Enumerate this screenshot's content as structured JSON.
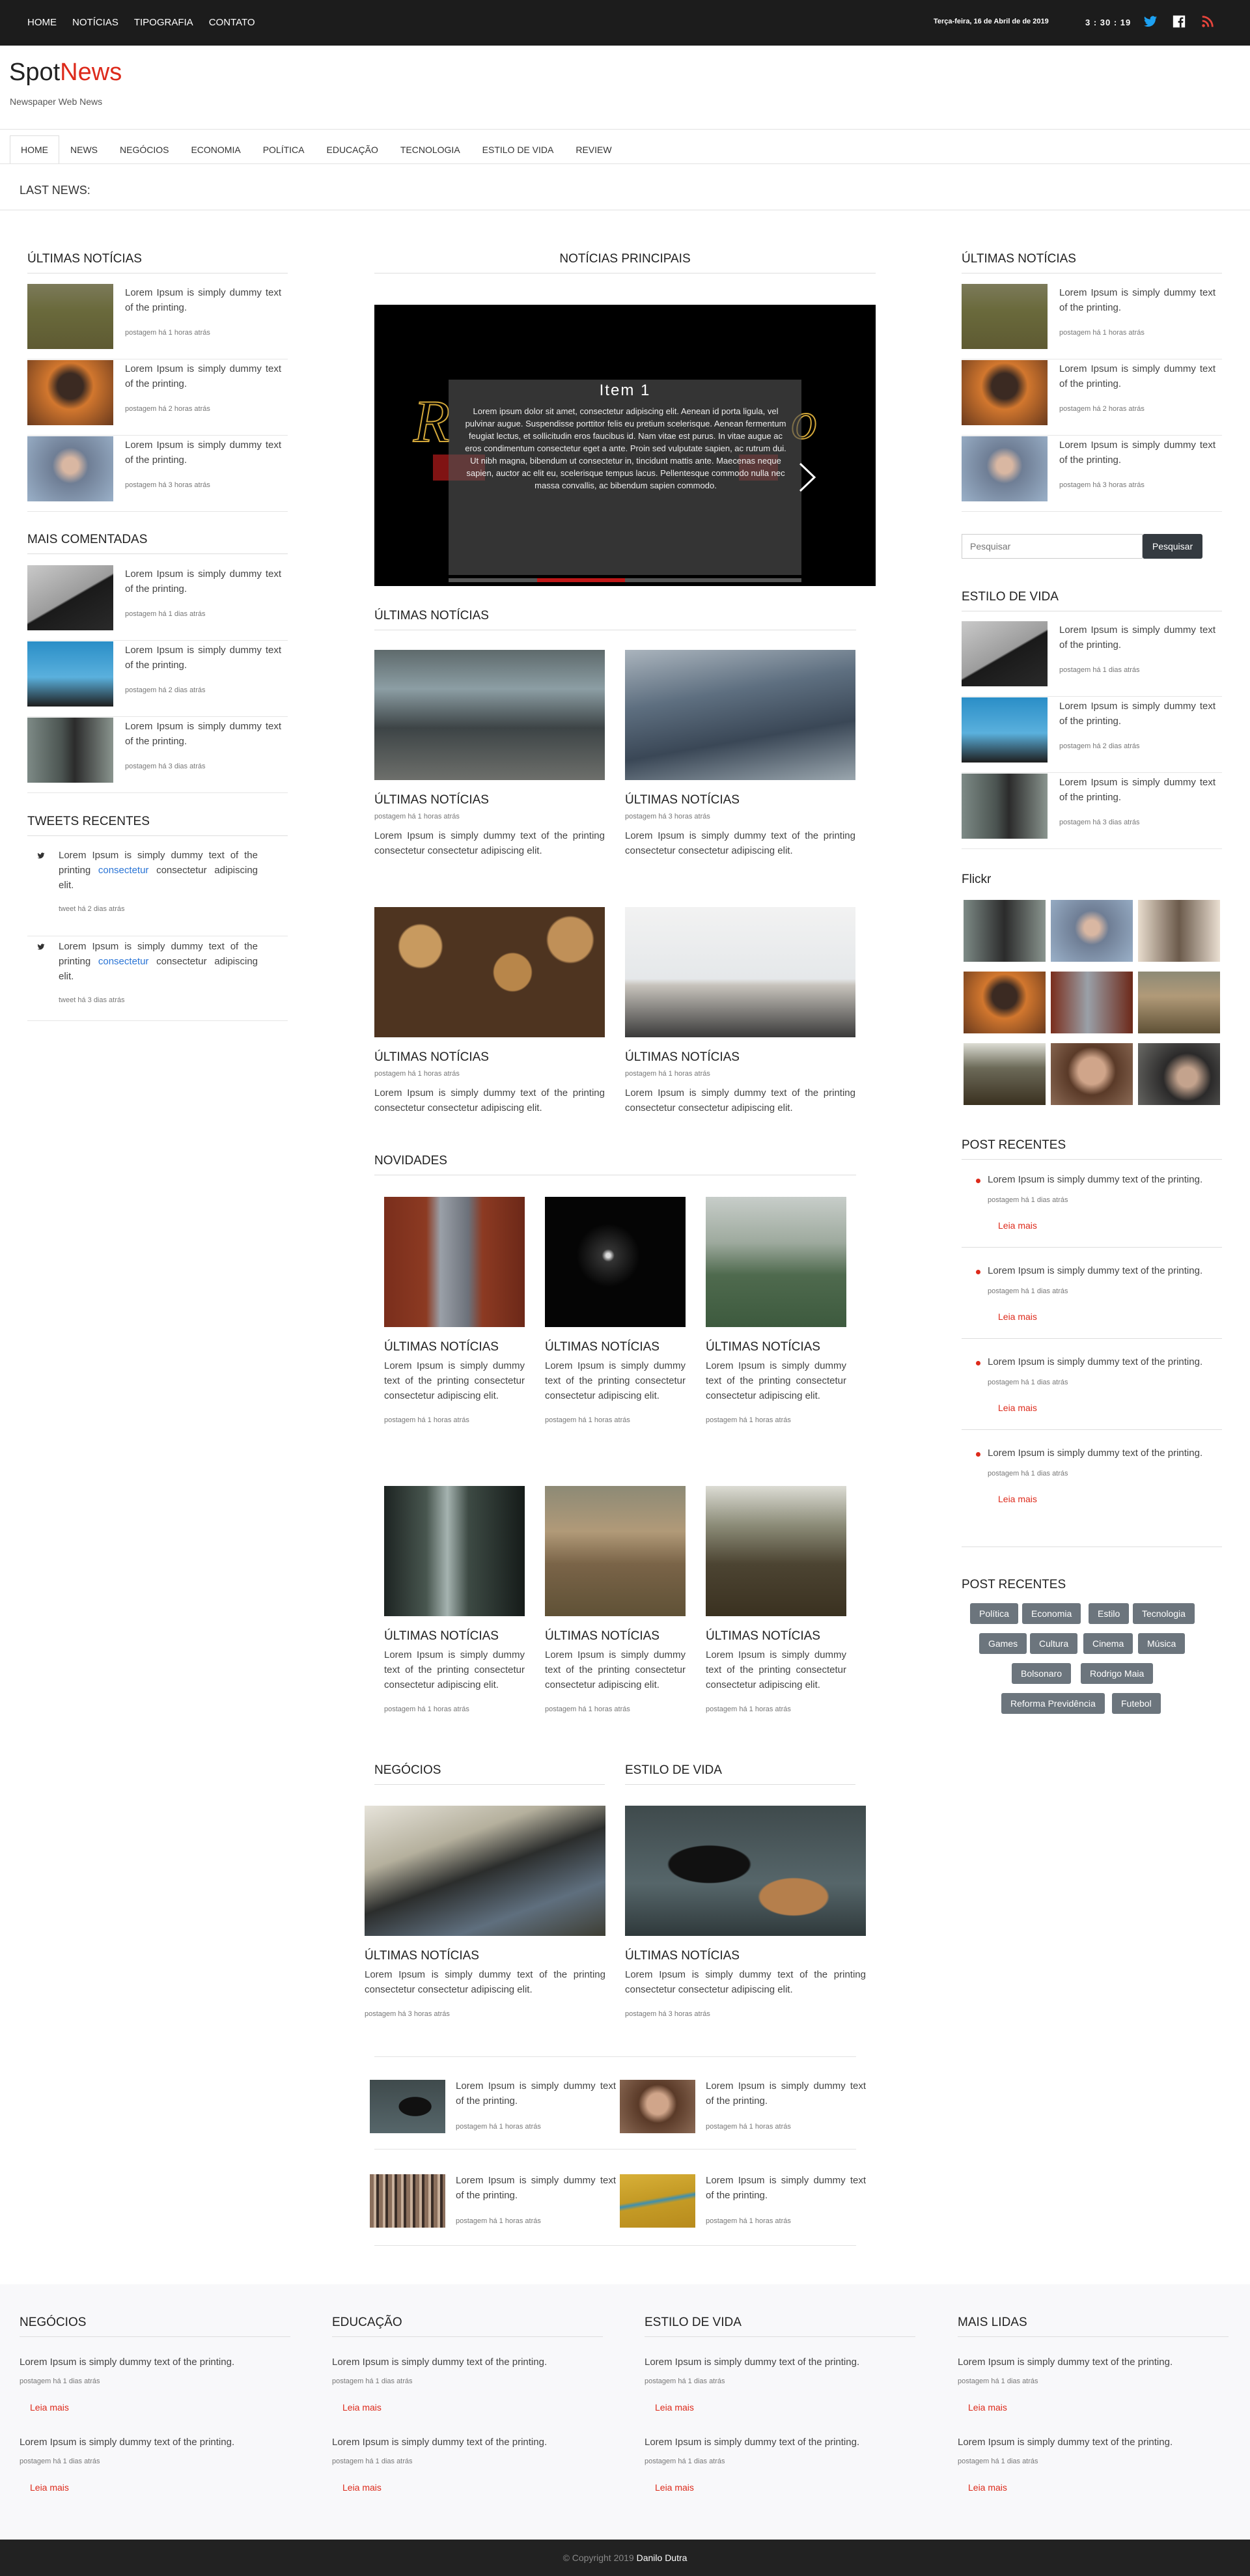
{
  "topbar": {
    "nav": [
      "HOME",
      "NOTÍCIAS",
      "TIPOGRAFIA",
      "CONTATO"
    ],
    "date": "Terça-feira, 16 de Abril de de 2019",
    "clock": "3 : 30 : 19",
    "social_icons": [
      "twitter-icon",
      "facebook-icon",
      "rss-icon"
    ],
    "colors": {
      "twitter": "#1da1f2",
      "rss": "#e8453c"
    }
  },
  "brand": {
    "part1": "Spot",
    "part2": "News",
    "tagline": "Newspaper Web News",
    "accent": "#dd2a1b"
  },
  "menu": [
    "HOME",
    "NEWS",
    "NEGÓCIOS",
    "ECONOMIA",
    "POLÍTICA",
    "EDUCAÇÃO",
    "TECNOLOGIA",
    "ESTILO DE VIDA",
    "REVIEW"
  ],
  "last_news": "LAST NEWS:",
  "left": {
    "ultimas": {
      "title": "ÚLTIMAS NOTÍCIAS",
      "items": [
        {
          "text": "Lorem Ipsum is simply dummy text of the printing.",
          "meta": "postagem há 1 horas atrás"
        },
        {
          "text": "Lorem Ipsum is simply dummy text of the printing.",
          "meta": "postagem há 2 horas atrás"
        },
        {
          "text": "Lorem Ipsum is simply dummy text of the printing.",
          "meta": "postagem há 3 horas atrás"
        }
      ]
    },
    "comentadas": {
      "title": "MAIS COMENTADAS",
      "items": [
        {
          "text": "Lorem Ipsum is simply dummy text of the printing.",
          "meta": "postagem há 1 dias atrás"
        },
        {
          "text": "Lorem Ipsum is simply dummy text of the printing.",
          "meta": "postagem há 2 dias atrás"
        },
        {
          "text": "Lorem Ipsum is simply dummy text of the printing.",
          "meta": "postagem há 3 dias atrás"
        }
      ]
    },
    "tweets": {
      "title": "TWEETS RECENTES",
      "items": [
        {
          "pre": "Lorem Ipsum is simply dummy text of the printing",
          "link": "consectetur",
          "post": "consectetur adipiscing elit.",
          "meta": "tweet há 2 dias atrás"
        },
        {
          "pre": "Lorem Ipsum is simply dummy text of the printing",
          "link": "consectetur",
          "post": "consectetur adipiscing elit.",
          "meta": "tweet há 3 dias atrás"
        }
      ]
    }
  },
  "center": {
    "principais": "NOTÍCIAS PRINCIPAIS",
    "slider": {
      "title": "Item 1",
      "text": "Lorem ipsum dolor sit amet, consectetur adipiscing elit. Aenean id porta ligula, vel pulvinar augue. Suspendisse porttitor felis eu pretium scelerisque. Aenean fermentum feugiat lectus, et sollicitudin eros faucibus id. Nam vitae est purus. In vitae augue ac eros condimentum consectetur eget a ante. Proin sed vulputate sapien, ac rutrum dui. Ut nibh magna, bibendum ut consectetur in, tincidunt mattis ante. Maecenas neque sapien, auctor ac elit eu, scelerisque tempus lacus. Pellentesque commodo nulla nec massa convallis, ac bibendum sapien commodo."
    },
    "ultimas_title": "ÚLTIMAS NOTÍCIAS",
    "ultimas": [
      {
        "title": "ÚLTIMAS NOTÍCIAS",
        "meta": "postagem há 1 horas atrás",
        "desc": "Lorem Ipsum is simply dummy text of the printing consectetur consectetur adipiscing elit."
      },
      {
        "title": "ÚLTIMAS NOTÍCIAS",
        "meta": "postagem há 3 horas atrás",
        "desc": "Lorem Ipsum is simply dummy text of the printing consectetur consectetur adipiscing elit."
      },
      {
        "title": "ÚLTIMAS NOTÍCIAS",
        "meta": "postagem há 1 horas atrás",
        "desc": "Lorem Ipsum is simply dummy text of the printing consectetur consectetur adipiscing elit."
      },
      {
        "title": "ÚLTIMAS NOTÍCIAS",
        "meta": "postagem há 1 horas atrás",
        "desc": "Lorem Ipsum is simply dummy text of the printing consectetur consectetur adipiscing elit."
      }
    ],
    "novidades_title": "NOVIDADES",
    "novidades": [
      {
        "title": "ÚLTIMAS NOTÍCIAS",
        "desc": "Lorem Ipsum is simply dummy text of the printing consectetur consectetur adipiscing elit.",
        "meta": "postagem há 1 horas atrás"
      },
      {
        "title": "ÚLTIMAS NOTÍCIAS",
        "desc": "Lorem Ipsum is simply dummy text of the printing consectetur consectetur adipiscing elit.",
        "meta": "postagem há 1 horas atrás"
      },
      {
        "title": "ÚLTIMAS NOTÍCIAS",
        "desc": "Lorem Ipsum is simply dummy text of the printing consectetur consectetur adipiscing elit.",
        "meta": "postagem há 1 horas atrás"
      },
      {
        "title": "ÚLTIMAS NOTÍCIAS",
        "desc": "Lorem Ipsum is simply dummy text of the printing consectetur consectetur adipiscing elit.",
        "meta": "postagem há 1 horas atrás"
      },
      {
        "title": "ÚLTIMAS NOTÍCIAS",
        "desc": "Lorem Ipsum is simply dummy text of the printing consectetur consectetur adipiscing elit.",
        "meta": "postagem há 1 horas atrás"
      },
      {
        "title": "ÚLTIMAS NOTÍCIAS",
        "desc": "Lorem Ipsum is simply dummy text of the printing consectetur consectetur adipiscing elit.",
        "meta": "postagem há 1 horas atrás"
      }
    ],
    "negocios_title": "NEGÓCIOS",
    "estilo_title": "ESTILO DE VIDA",
    "negocios": {
      "title": "ÚLTIMAS NOTÍCIAS",
      "desc": "Lorem Ipsum is simply dummy text of the printing consectetur consectetur adipiscing elit.",
      "meta": "postagem há 3 horas atrás"
    },
    "estilo": {
      "title": "ÚLTIMAS NOTÍCIAS",
      "desc": "Lorem Ipsum is simply dummy text of the printing consectetur consectetur adipiscing elit.",
      "meta": "postagem há 3 horas atrás"
    },
    "minis": [
      {
        "text": "Lorem Ipsum is simply dummy text of the printing.",
        "meta": "postagem há 1 horas atrás"
      },
      {
        "text": "Lorem Ipsum is simply dummy text of the printing.",
        "meta": "postagem há 1 horas atrás"
      },
      {
        "text": "Lorem Ipsum is simply dummy text of the printing.",
        "meta": "postagem há 1 horas atrás"
      },
      {
        "text": "Lorem Ipsum is simply dummy text of the printing.",
        "meta": "postagem há 1 horas atrás"
      }
    ]
  },
  "right": {
    "ultimas": {
      "title": "ÚLTIMAS NOTÍCIAS",
      "items": [
        {
          "text": "Lorem Ipsum is simply dummy text of the printing.",
          "meta": "postagem há 1 horas atrás"
        },
        {
          "text": "Lorem Ipsum is simply dummy text of the printing.",
          "meta": "postagem há 2 horas atrás"
        },
        {
          "text": "Lorem Ipsum is simply dummy text of the printing.",
          "meta": "postagem há 3 horas atrás"
        }
      ]
    },
    "search": {
      "placeholder": "Pesquisar",
      "button": "Pesquisar"
    },
    "estilo": {
      "title": "ESTILO DE VIDA",
      "items": [
        {
          "text": "Lorem Ipsum is simply dummy text of the printing.",
          "meta": "postagem há 1 dias atrás"
        },
        {
          "text": "Lorem Ipsum is simply dummy text of the printing.",
          "meta": "postagem há 2 dias atrás"
        },
        {
          "text": "Lorem Ipsum is simply dummy text of the printing.",
          "meta": "postagem há 3 dias atrás"
        }
      ]
    },
    "flickr_title": "Flickr",
    "posts": {
      "title": "POST RECENTES",
      "items": [
        {
          "text": "Lorem Ipsum is simply dummy text of the printing.",
          "meta": "postagem há 1 dias atrás",
          "more": "Leia mais"
        },
        {
          "text": "Lorem Ipsum is simply dummy text of the printing.",
          "meta": "postagem há 1 dias atrás",
          "more": "Leia mais"
        },
        {
          "text": "Lorem Ipsum is simply dummy text of the printing.",
          "meta": "postagem há 1 dias atrás",
          "more": "Leia mais"
        },
        {
          "text": "Lorem Ipsum is simply dummy text of the printing.",
          "meta": "postagem há 1 dias atrás",
          "more": "Leia mais"
        }
      ]
    },
    "tags_title": "POST RECENTES",
    "tags": [
      "Política",
      "Economia",
      "Estilo",
      "Tecnologia",
      "Games",
      "Cultura",
      "Cinema",
      "Música",
      "Bolsonaro",
      "Rodrigo Maia",
      "Reforma Previdência",
      "Futebol"
    ]
  },
  "footer": {
    "columns": [
      {
        "title": "NEGÓCIOS",
        "items": [
          {
            "text": "Lorem Ipsum is simply dummy text of the printing.",
            "meta": "postagem há 1 dias atrás",
            "more": "Leia mais"
          },
          {
            "text": "Lorem Ipsum is simply dummy text of the printing.",
            "meta": "postagem há 1 dias atrás",
            "more": "Leia mais"
          }
        ]
      },
      {
        "title": "EDUCAÇÃO",
        "items": [
          {
            "text": "Lorem Ipsum is simply dummy text of the printing.",
            "meta": "postagem há 1 dias atrás",
            "more": "Leia mais"
          },
          {
            "text": "Lorem Ipsum is simply dummy text of the printing.",
            "meta": "postagem há 1 dias atrás",
            "more": "Leia mais"
          }
        ]
      },
      {
        "title": "ESTILO DE VIDA",
        "items": [
          {
            "text": "Lorem Ipsum is simply dummy text of the printing.",
            "meta": "postagem há 1 dias atrás",
            "more": "Leia mais"
          },
          {
            "text": "Lorem Ipsum is simply dummy text of the printing.",
            "meta": "postagem há 1 dias atrás",
            "more": "Leia mais"
          }
        ]
      },
      {
        "title": "MAIS LIDAS",
        "items": [
          {
            "text": "Lorem Ipsum is simply dummy text of the printing.",
            "meta": "postagem há 1 dias atrás",
            "more": "Leia mais"
          },
          {
            "text": "Lorem Ipsum is simply dummy text of the printing.",
            "meta": "postagem há 1 dias atrás",
            "more": "Leia mais"
          }
        ]
      }
    ],
    "copyright": "© Copyright 2019",
    "author": "Danilo Dutra"
  }
}
